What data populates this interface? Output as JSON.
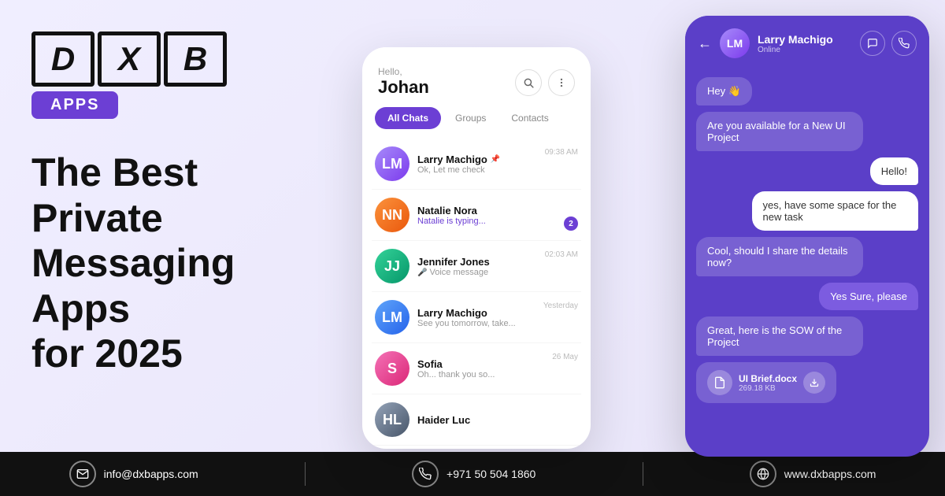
{
  "logo": {
    "letters": "DXB",
    "badge": "APPS"
  },
  "headline": {
    "line1": "The Best Private",
    "line2": "Messaging Apps",
    "line3": "for 2025"
  },
  "chat_list_phone": {
    "greeting": "Hello,",
    "user_name": "Johan",
    "tabs": [
      "All Chats",
      "Groups",
      "Contacts"
    ],
    "active_tab": "All Chats",
    "chats": [
      {
        "name": "Larry Machigo",
        "preview": "Ok, Let me check",
        "time": "09:38 AM",
        "pinned": true,
        "unread": 0,
        "initials": "LM"
      },
      {
        "name": "Natalie Nora",
        "preview": "Natalie is typing...",
        "time": "",
        "pinned": false,
        "unread": 2,
        "initials": "NN"
      },
      {
        "name": "Jennifer Jones",
        "preview": "Voice message",
        "time": "02:03 AM",
        "pinned": false,
        "unread": 0,
        "initials": "JJ",
        "is_voice": true
      },
      {
        "name": "Larry Machigo",
        "preview": "See you tomorrow, take...",
        "time": "Yesterday",
        "pinned": false,
        "unread": 0,
        "initials": "LM"
      },
      {
        "name": "Sofia",
        "preview": "Oh... thank you so...",
        "time": "26 May",
        "pinned": false,
        "unread": 0,
        "initials": "S"
      },
      {
        "name": "Haider Luc",
        "preview": "",
        "time": "",
        "pinned": false,
        "unread": 0,
        "initials": "HL"
      }
    ]
  },
  "chat_convo_phone": {
    "contact_name": "Larry Machigo",
    "status": "Online",
    "messages": [
      {
        "type": "received",
        "text": "Hey 👋"
      },
      {
        "type": "received",
        "text": "Are you available for a New UI Project"
      },
      {
        "type": "sent_white",
        "text": "Hello!"
      },
      {
        "type": "sent_white",
        "text": "yes, have some space for the new task"
      },
      {
        "type": "received",
        "text": "Cool, should I share the details now?"
      },
      {
        "type": "sent_purple",
        "text": "Yes Sure, please"
      },
      {
        "type": "received",
        "text": "Great, here is the SOW of the Project"
      },
      {
        "type": "file",
        "name": "UI Brief.docx",
        "size": "269.18 KB"
      }
    ]
  },
  "footer": {
    "email_icon": "✉",
    "email": "info@dxbapps.com",
    "phone_icon": "📞",
    "phone": "+971 50 504 1860",
    "globe_icon": "🌐",
    "website": "www.dxbapps.com"
  }
}
